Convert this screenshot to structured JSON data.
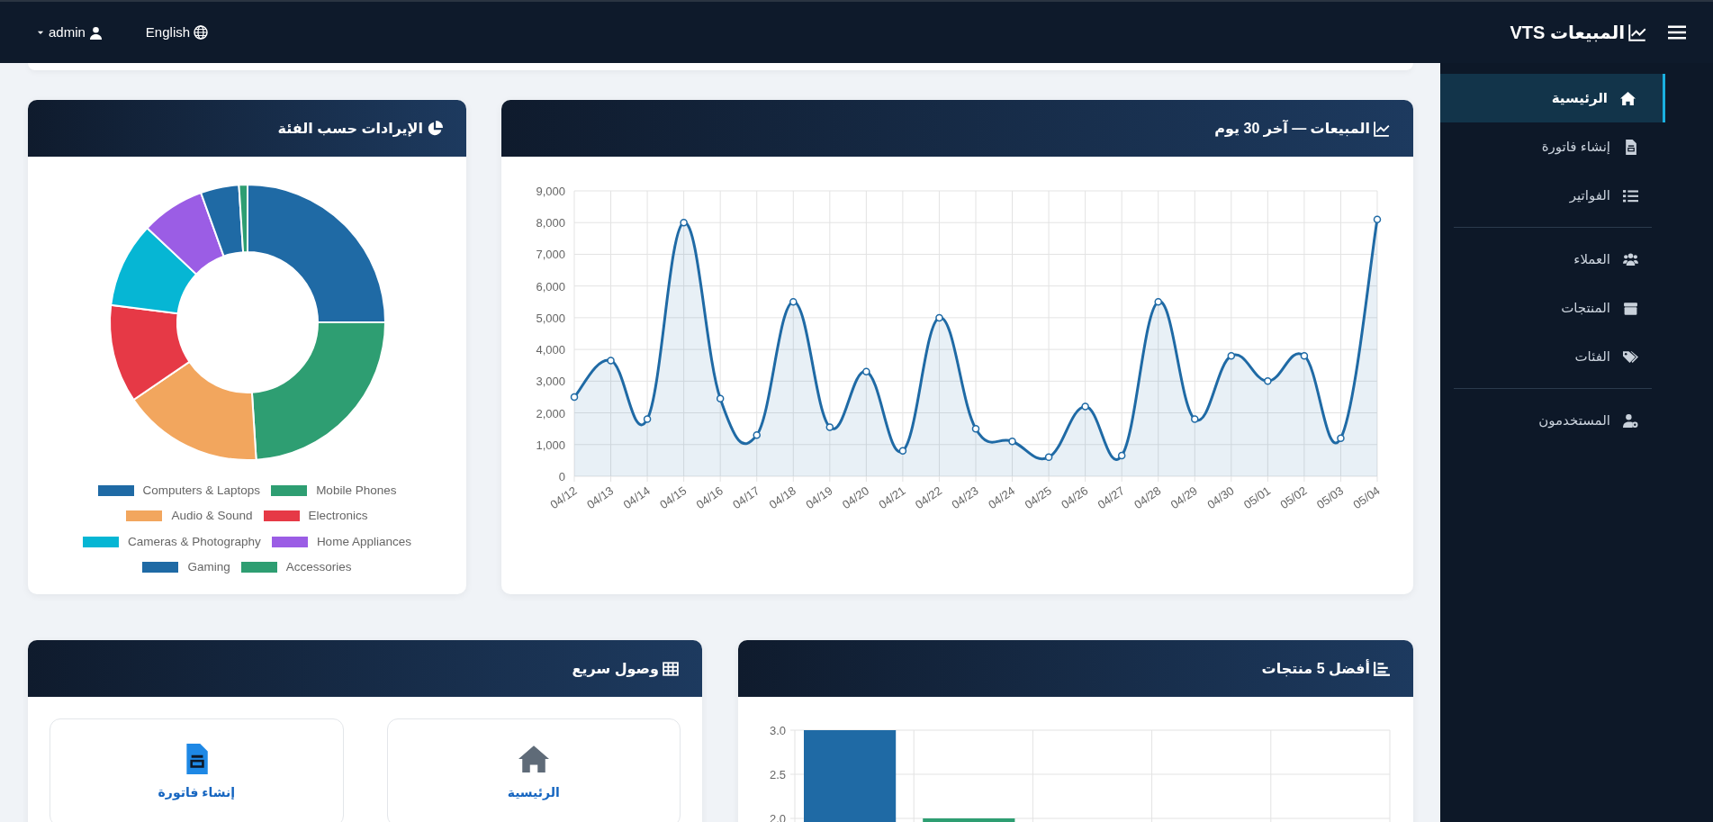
{
  "topbar": {
    "brand": "المبيعات VTS",
    "language": "English",
    "user": "admin"
  },
  "sidebar": {
    "sections": [
      {
        "items": [
          {
            "label": "الرئيسية",
            "selected": true
          },
          {
            "label": "إنشاء فاتورة",
            "selected": false
          },
          {
            "label": "الفواتير",
            "selected": false
          }
        ]
      },
      {
        "items": [
          {
            "label": "العملاء",
            "selected": false
          },
          {
            "label": "المنتجات",
            "selected": false
          },
          {
            "label": "الفئات",
            "selected": false
          }
        ]
      },
      {
        "items": [
          {
            "label": "المستخدمون",
            "selected": false
          }
        ]
      }
    ]
  },
  "sales_card": {
    "title": "المبيعات — آخر 30 يوم",
    "chart_data": {
      "type": "area",
      "grid": true,
      "categories": [
        "04/12",
        "04/13",
        "04/14",
        "04/15",
        "04/16",
        "04/17",
        "04/18",
        "04/19",
        "04/20",
        "04/21",
        "04/22",
        "04/23",
        "04/24",
        "04/25",
        "04/26",
        "04/27",
        "04/28",
        "04/29",
        "04/30",
        "05/01",
        "05/02",
        "05/03",
        "05/04"
      ],
      "series": [
        {
          "color": "#1f6aa5",
          "values": [
            2500,
            3650,
            1800,
            8000,
            2450,
            1300,
            5500,
            1550,
            3300,
            800,
            5000,
            1500,
            1100,
            600,
            2200,
            650,
            5500,
            1800,
            3800,
            3000,
            3800,
            1200,
            8100
          ]
        }
      ],
      "ylim": [
        0,
        9000
      ],
      "yticks": [
        {
          "value": 0,
          "label": "0"
        },
        {
          "value": 1000,
          "label": "1,000"
        },
        {
          "value": 2000,
          "label": "2,000"
        },
        {
          "value": 3000,
          "label": "3,000"
        },
        {
          "value": 4000,
          "label": "4,000"
        },
        {
          "value": 5000,
          "label": "5,000"
        },
        {
          "value": 6000,
          "label": "6,000"
        },
        {
          "value": 7000,
          "label": "7,000"
        },
        {
          "value": 8000,
          "label": "8,000"
        },
        {
          "value": 9000,
          "label": "9,000"
        }
      ]
    }
  },
  "revenue_card": {
    "title": "الإيرادات حسب الفئة",
    "chart_data": {
      "type": "donut",
      "categories": [
        "Computers & Laptops",
        "Mobile Phones",
        "Audio & Sound",
        "Electronics",
        "Cameras & Photography",
        "Home Appliances",
        "Gaming",
        "Accessories"
      ],
      "series": [
        {
          "values": [
            25,
            24,
            16.5,
            11.5,
            10,
            7.5,
            4.5,
            1
          ]
        }
      ],
      "colors": [
        "#1f6aa5",
        "#2e9e72",
        "#f2a65e",
        "#e63946",
        "#06b6d4",
        "#9b5de5",
        "#1f6aa5",
        "#2e9e72"
      ]
    }
  },
  "top_products_card": {
    "title": "أفضل 5 منتجات",
    "chart_data": {
      "type": "bar",
      "grid": true,
      "series": [
        {
          "values": [
            3,
            2,
            null,
            null,
            null
          ]
        }
      ],
      "colors": [
        "#1f6aa5",
        "#2e9e72"
      ],
      "ylim": [
        0,
        3
      ],
      "yticks": [
        {
          "value": 2,
          "label": "2.0"
        },
        {
          "value": 2.5,
          "label": "2.5"
        },
        {
          "value": 3,
          "label": "3.0"
        }
      ]
    }
  },
  "quick_access_card": {
    "title": "وصول سريع",
    "links": [
      {
        "label": "الرئيسية"
      },
      {
        "label": "إنشاء فاتورة"
      }
    ]
  }
}
